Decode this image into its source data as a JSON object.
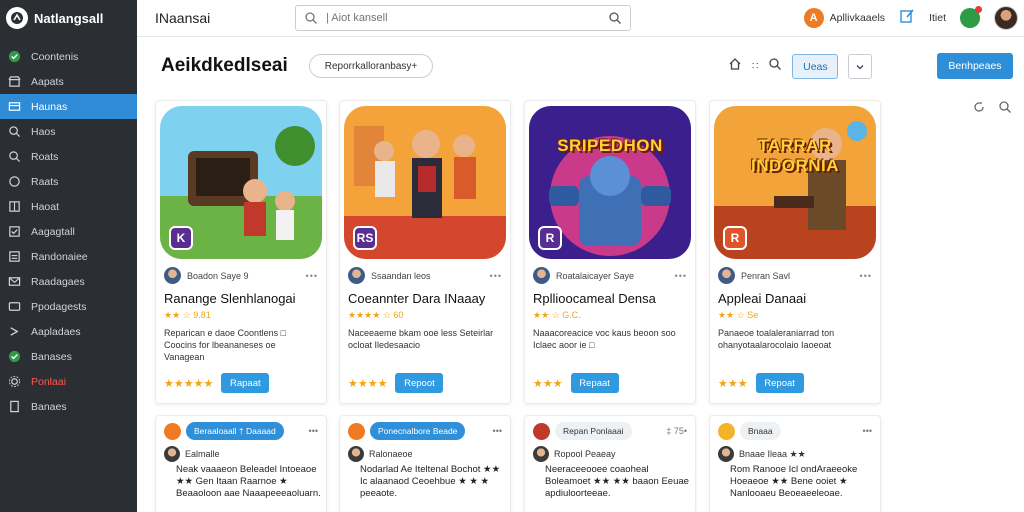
{
  "sidebar": {
    "brand": "Natlangsall",
    "items": [
      {
        "label": "Coontenis",
        "icon": "circle-check-icon",
        "color": "#2e9b47"
      },
      {
        "label": "Aapats",
        "icon": "store-icon"
      },
      {
        "label": "Haunas",
        "icon": "folder-icon",
        "active": true
      },
      {
        "label": "Haos",
        "icon": "search-icon"
      },
      {
        "label": "Roats",
        "icon": "search-icon"
      },
      {
        "label": "Raats",
        "icon": "circle-icon"
      },
      {
        "label": "Haoat",
        "icon": "grid-icon"
      },
      {
        "label": "Aagagtall",
        "icon": "checkbox-icon"
      },
      {
        "label": "Randonaiee",
        "icon": "list-icon"
      },
      {
        "label": "Raadagaes",
        "icon": "mail-icon"
      },
      {
        "label": "Ppodagests",
        "icon": "card-icon"
      },
      {
        "label": "Aapladaes",
        "icon": "arrow-icon"
      },
      {
        "label": "Banases",
        "icon": "circle-check-icon",
        "color": "#2e9b47"
      },
      {
        "label": "Ponlaai",
        "icon": "gear-icon",
        "danger": true
      },
      {
        "label": "Banaes",
        "icon": "document-icon"
      }
    ]
  },
  "topbar": {
    "title": "INaansai",
    "search_placeholder": "| Aiot kansell",
    "app_label": "Apllivkaaels",
    "link_text": "Itiet"
  },
  "header": {
    "title": "Aeikdkedlseai",
    "filter": "Reporrkalloranbasy+",
    "tools_text": "∷",
    "outline_button": "Ueas",
    "primary_button": "Benhpeaes"
  },
  "cards": [
    {
      "thumb_title": "",
      "badge": "K",
      "meta": "Boadon Saye 9",
      "name": "Ranange Slenhlanogai",
      "rating": "★★ ☆ 9.81",
      "desc": "Reparican e daoe Coontlens □ Coocins for lbeananeses oe Vanagean",
      "stars": "★★★★★",
      "button": "Rapaat",
      "colors": [
        "#7fd1f0",
        "#6bb345",
        "#b8732c"
      ]
    },
    {
      "thumb_title": "",
      "badge": "RS",
      "meta": "Ssaandan leos",
      "name": "Coeannter Dara INaaay",
      "rating": "★★★★ ☆ 60",
      "desc": "Naceeaeme bkam ooe less Seteirlar ocloat Iledesaacio",
      "stars": "★★★★",
      "button": "Repoot",
      "colors": [
        "#f4a23a",
        "#d4462d",
        "#6b2a1a"
      ]
    },
    {
      "thumb_title": "SRIPEDHON",
      "badge": "R",
      "meta": "Roatalaicayer Saye",
      "name": "Rpllioocameal Densa",
      "rating": "★★ ☆ G.C.",
      "desc": "Naaacoreacice voc kaus beoon soo Iclaec aoor ie □",
      "stars": "★★★",
      "button": "Repaat",
      "colors": [
        "#3b1f8c",
        "#c93a8a",
        "#f3b23a"
      ]
    },
    {
      "thumb_title": "TARRAR INDORNIA",
      "badge": "R",
      "meta": "Penran Savl",
      "name": "Appleai Danaai",
      "rating": "★★ ☆ Se",
      "desc": "Panaeoe toalaleraniarrad ton ohanyotaalarocolaio Iaoeoat",
      "stars": "★★★",
      "button": "Repoat",
      "colors": [
        "#f2a33a",
        "#b9421f",
        "#4a2a1a"
      ]
    }
  ],
  "bottom_cards": [
    {
      "tag": "Beraaloaall † Daaaad",
      "more": "•••",
      "sub": "Ealmalle",
      "desc": "Neak vaaaeon Beleadel Intoeaoe ★★ Gen Itaan Raarnoe ★ Beaaoloon aae Naaapeeeaoluarn."
    },
    {
      "tag": "Ponecnalbore Beade",
      "more": "•••",
      "sub": "Ralonaeoe",
      "desc": "Nodarlad Ae Iteltenal Bochot ★★ Ic alaanaod Ceoehbue ★ ★ ★ peeaote."
    },
    {
      "tag": "Repan Ponlaaai",
      "more": "‡ 75•",
      "sub": "Ropool Peaeay",
      "desc": "Neeraceeooee coaoheal Boleamoet ★★ ★★ baaon Eeuae apdiuloorteeae."
    },
    {
      "tag": "Bnaaa",
      "more": "•••",
      "sub": "Bnaae Ileaa ★★",
      "desc": "Rom Ranooe Icl ondAraeeoke Hoeaeoe ★★ Bene ooiet ★ Nanlooaeu Beoeaeeleoae."
    }
  ]
}
